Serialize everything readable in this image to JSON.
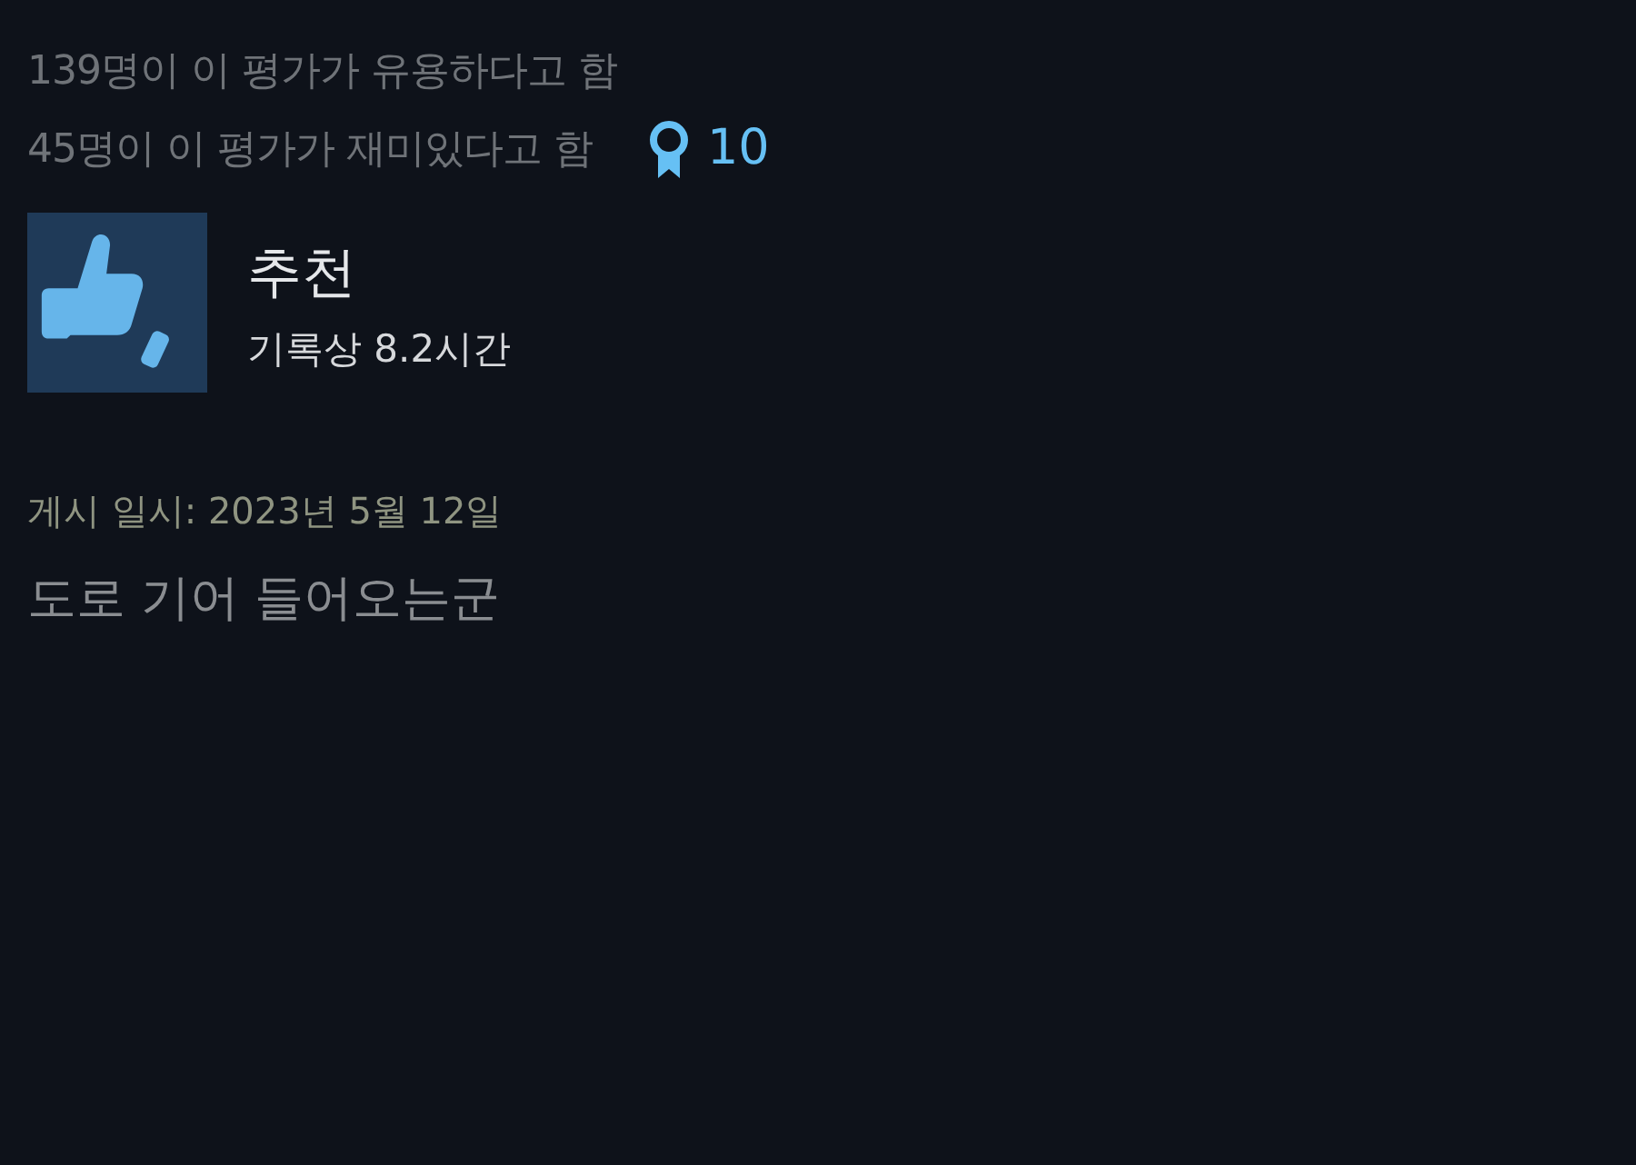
{
  "votes": [
    {
      "text": "139명이 이 평가가 유용하다고 함"
    },
    {
      "text": "45명이 이 평가가 재미있다고 함",
      "award_count": "10"
    }
  ],
  "review": {
    "recommended": true,
    "verdict": "추천",
    "playtime": "기록상 8.2시간",
    "posted": "게시 일시: 2023년 5월 12일",
    "body": "도로 기어 들어오는군"
  }
}
